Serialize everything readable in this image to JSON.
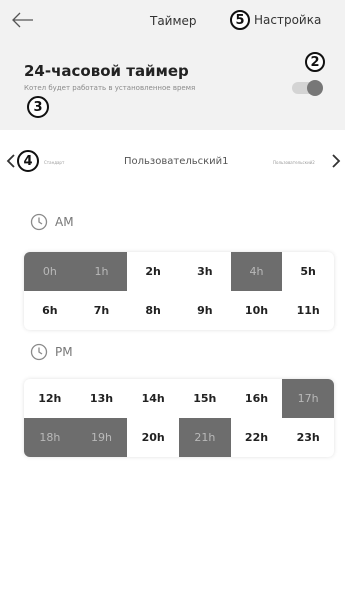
{
  "header": {
    "title": "Таймер",
    "settings_label": "Настройка",
    "settings_marker": "5",
    "back_icon": "arrow-left-icon"
  },
  "timer": {
    "title": "24-часовой таймер",
    "description": "Котел будет работать в установленное время",
    "toggle_on": true,
    "toggle_marker": "2",
    "title_marker": "3"
  },
  "profiles": {
    "marker": "4",
    "prev": "Стандарт",
    "current": "Пользовательский1",
    "next": "Пользовательский2"
  },
  "am": {
    "label": "AM",
    "hours": [
      {
        "label": "0h",
        "active": true
      },
      {
        "label": "1h",
        "active": true
      },
      {
        "label": "2h",
        "active": false
      },
      {
        "label": "3h",
        "active": false
      },
      {
        "label": "4h",
        "active": true
      },
      {
        "label": "5h",
        "active": false
      },
      {
        "label": "6h",
        "active": false
      },
      {
        "label": "7h",
        "active": false
      },
      {
        "label": "8h",
        "active": false
      },
      {
        "label": "9h",
        "active": false
      },
      {
        "label": "10h",
        "active": false
      },
      {
        "label": "11h",
        "active": false
      }
    ]
  },
  "pm": {
    "label": "PM",
    "hours": [
      {
        "label": "12h",
        "active": false
      },
      {
        "label": "13h",
        "active": false
      },
      {
        "label": "14h",
        "active": false
      },
      {
        "label": "15h",
        "active": false
      },
      {
        "label": "16h",
        "active": false
      },
      {
        "label": "17h",
        "active": true
      },
      {
        "label": "18h",
        "active": true
      },
      {
        "label": "19h",
        "active": true
      },
      {
        "label": "20h",
        "active": false
      },
      {
        "label": "21h",
        "active": true
      },
      {
        "label": "22h",
        "active": false
      },
      {
        "label": "23h",
        "active": false
      }
    ]
  },
  "colors": {
    "active_cell": "#6d6d6d",
    "active_text": "#b9b9b9",
    "panel_bg": "#f2f2f2"
  }
}
